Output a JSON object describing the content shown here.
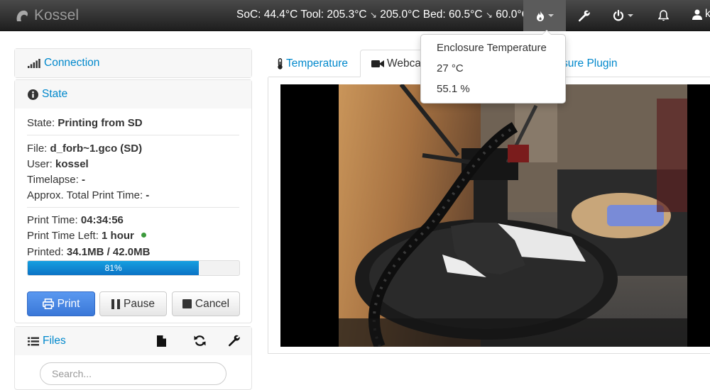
{
  "navbar": {
    "brand": "Kossel",
    "status": {
      "soc": "SoC: 44.4°C",
      "tool": "Tool: 205.3°C",
      "tool_target": "205.0°C",
      "bed": "Bed: 60.5°C",
      "bed_target": "60.0°C",
      "arrow": "↘"
    },
    "user": "k"
  },
  "dropdown": {
    "title": "Enclosure Temperature",
    "temperature": "27 °C",
    "humidity": "55.1 %"
  },
  "connection": {
    "title": "Connection"
  },
  "state": {
    "title": "State",
    "state_label": "State:",
    "state_value": "Printing from SD",
    "file_label": "File:",
    "file_value": "d_forb~1.gco (SD)",
    "user_label": "User:",
    "user_value": "kossel",
    "timelapse_label": "Timelapse:",
    "timelapse_value": "-",
    "approx_label": "Approx. Total Print Time:",
    "approx_value": "-",
    "print_time_label": "Print Time:",
    "print_time_value": "04:34:56",
    "time_left_label": "Print Time Left:",
    "time_left_value": "1 hour",
    "printed_label": "Printed:",
    "printed_value": "34.1MB / 42.0MB",
    "progress_label": "81%",
    "progress_fraction": 0.81
  },
  "controls": {
    "print": "Print",
    "pause": "Pause",
    "cancel": "Cancel"
  },
  "files": {
    "title": "Files",
    "search_placeholder": "Search..."
  },
  "tabs": {
    "temperature": "Temperature",
    "webcam": "Webcam",
    "plugin": "sure Plugin"
  },
  "colors": {
    "accent": "#0088cc",
    "primary_button": "#3a78d8",
    "progress": "#0b73c5",
    "status_dot": "#3c9a3c"
  }
}
